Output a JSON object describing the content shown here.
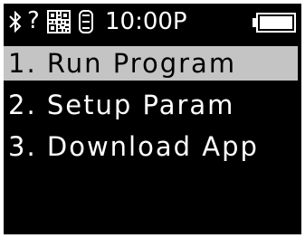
{
  "status_bar": {
    "bluetooth_icon": "bluetooth-icon",
    "signal_text": "?",
    "barcode_icon": "qr-code-icon",
    "scanner_icon": "scanner-icon",
    "time": "10:00P",
    "battery_icon": "battery-full-icon"
  },
  "menu": {
    "selected_index": 0,
    "items": [
      {
        "label": "1. Run Program"
      },
      {
        "label": "2. Setup Param"
      },
      {
        "label": "3. Download App"
      }
    ]
  },
  "colors": {
    "screen_background": "#000000",
    "text": "#ffffff",
    "selection_background": "#c4c4c4",
    "selection_text": "#000000"
  }
}
